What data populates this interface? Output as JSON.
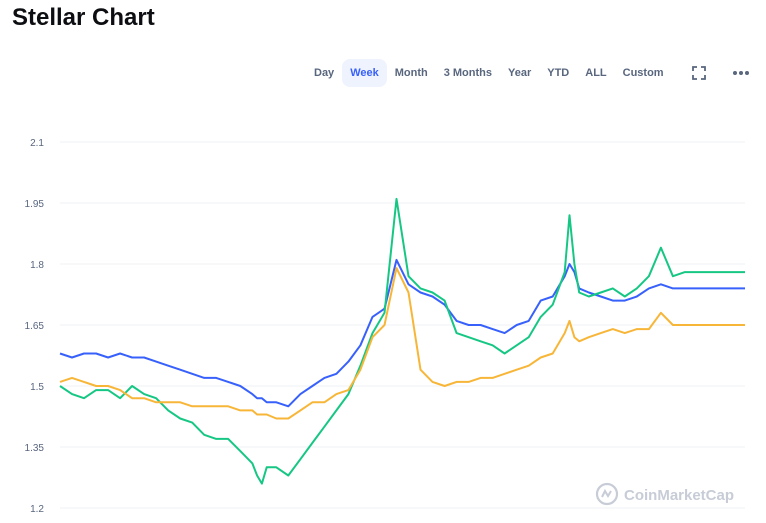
{
  "page": {
    "title": "Stellar Chart"
  },
  "toolbar": {
    "ranges": [
      "Day",
      "Week",
      "Month",
      "3 Months",
      "Year",
      "YTD",
      "ALL",
      "Custom"
    ],
    "active": "Week",
    "fullscreen_icon": "fullscreen-icon",
    "more_icon": "more-horizontal-icon"
  },
  "watermark": {
    "text": "CoinMarketCap",
    "icon": "coinmarketcap-logo-icon"
  },
  "colors": {
    "blue": "#3861fb",
    "green": "#16c784",
    "orange": "#f7b638",
    "grid": "#eff2f5"
  },
  "chart_data": {
    "type": "line",
    "title": "",
    "xlabel": "",
    "ylabel": "",
    "ylim": [
      1.2,
      2.1
    ],
    "yticks": [
      "1.2",
      "1.35",
      "1.5",
      "1.65",
      "1.8",
      "1.95",
      "2.1"
    ],
    "grid": true,
    "x": [
      0,
      5,
      10,
      15,
      20,
      25,
      30,
      35,
      40,
      45,
      50,
      55,
      60,
      65,
      70,
      75,
      80,
      82,
      84,
      86,
      90,
      95,
      100,
      105,
      110,
      115,
      120,
      125,
      130,
      135,
      140,
      145,
      150,
      155,
      160,
      165,
      170,
      175,
      180,
      185,
      190,
      195,
      200,
      205,
      210,
      212,
      214,
      216,
      220,
      225,
      230,
      235,
      240,
      245,
      250,
      255,
      260,
      262,
      264,
      266,
      270,
      275,
      280,
      285
    ],
    "series": [
      {
        "color": "blue",
        "values": [
          1.58,
          1.57,
          1.58,
          1.58,
          1.57,
          1.58,
          1.57,
          1.57,
          1.56,
          1.55,
          1.54,
          1.53,
          1.52,
          1.52,
          1.51,
          1.5,
          1.48,
          1.47,
          1.47,
          1.46,
          1.46,
          1.45,
          1.48,
          1.5,
          1.52,
          1.53,
          1.56,
          1.6,
          1.67,
          1.69,
          1.81,
          1.75,
          1.73,
          1.72,
          1.7,
          1.66,
          1.65,
          1.65,
          1.64,
          1.63,
          1.65,
          1.66,
          1.71,
          1.72,
          1.77,
          1.8,
          1.78,
          1.74,
          1.73,
          1.72,
          1.71,
          1.71,
          1.72,
          1.74,
          1.75,
          1.74,
          1.74,
          1.74,
          1.74,
          1.74,
          1.74,
          1.74,
          1.74,
          1.74
        ]
      },
      {
        "color": "green",
        "values": [
          1.5,
          1.48,
          1.47,
          1.49,
          1.49,
          1.47,
          1.5,
          1.48,
          1.47,
          1.44,
          1.42,
          1.41,
          1.38,
          1.37,
          1.37,
          1.34,
          1.31,
          1.28,
          1.26,
          1.3,
          1.3,
          1.28,
          1.32,
          1.36,
          1.4,
          1.44,
          1.48,
          1.55,
          1.63,
          1.68,
          1.96,
          1.77,
          1.74,
          1.73,
          1.71,
          1.63,
          1.62,
          1.61,
          1.6,
          1.58,
          1.6,
          1.62,
          1.67,
          1.7,
          1.78,
          1.92,
          1.8,
          1.73,
          1.72,
          1.73,
          1.74,
          1.72,
          1.74,
          1.77,
          1.84,
          1.77,
          1.78,
          1.78,
          1.78,
          1.78,
          1.78,
          1.78,
          1.78,
          1.78
        ]
      },
      {
        "color": "orange",
        "values": [
          1.51,
          1.52,
          1.51,
          1.5,
          1.5,
          1.49,
          1.47,
          1.47,
          1.46,
          1.46,
          1.46,
          1.45,
          1.45,
          1.45,
          1.45,
          1.44,
          1.44,
          1.43,
          1.43,
          1.43,
          1.42,
          1.42,
          1.44,
          1.46,
          1.46,
          1.48,
          1.49,
          1.54,
          1.62,
          1.65,
          1.79,
          1.73,
          1.54,
          1.51,
          1.5,
          1.51,
          1.51,
          1.52,
          1.52,
          1.53,
          1.54,
          1.55,
          1.57,
          1.58,
          1.63,
          1.66,
          1.62,
          1.61,
          1.62,
          1.63,
          1.64,
          1.63,
          1.64,
          1.64,
          1.68,
          1.65,
          1.65,
          1.65,
          1.65,
          1.65,
          1.65,
          1.65,
          1.65,
          1.65
        ]
      }
    ]
  }
}
